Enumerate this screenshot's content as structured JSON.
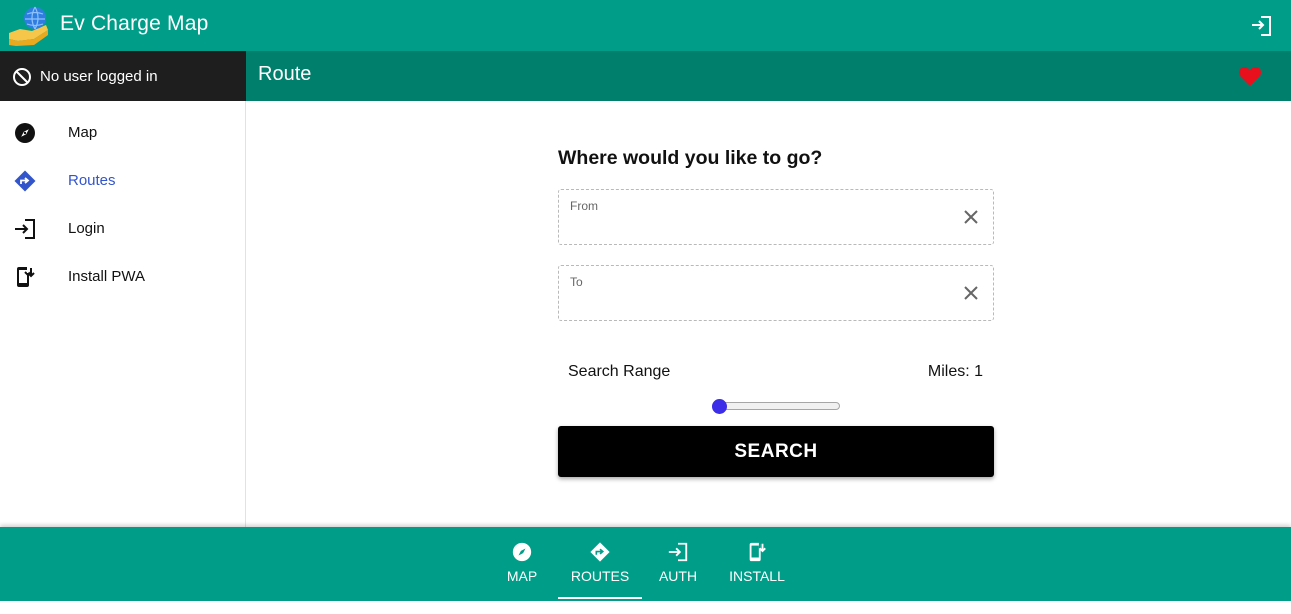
{
  "app": {
    "title": "Ev Charge Map"
  },
  "user": {
    "status": "No user logged in"
  },
  "header": {
    "title": "Route"
  },
  "sidebar": {
    "items": [
      {
        "label": "Map",
        "icon": "compass-icon"
      },
      {
        "label": "Routes",
        "icon": "directions-icon"
      },
      {
        "label": "Login",
        "icon": "login-icon"
      },
      {
        "label": "Install PWA",
        "icon": "install-phone-icon"
      }
    ]
  },
  "form": {
    "question": "Where would you like to go?",
    "from": {
      "label": "From",
      "value": ""
    },
    "to": {
      "label": "To",
      "value": ""
    },
    "range_label": "Search Range",
    "miles_text": "Miles: 1",
    "range_value": 1,
    "search_label": "SEARCH"
  },
  "bottom_nav": {
    "tabs": [
      {
        "label": "MAP"
      },
      {
        "label": "ROUTES"
      },
      {
        "label": "AUTH"
      },
      {
        "label": "INSTALL"
      }
    ],
    "active": "ROUTES"
  },
  "colors": {
    "primary": "#009e89",
    "primary_dark": "#007f6d",
    "userbar": "#1e1e1e",
    "active_nav": "#3355cc",
    "heart": "#e8101c",
    "slider_thumb": "#3b2de8"
  }
}
